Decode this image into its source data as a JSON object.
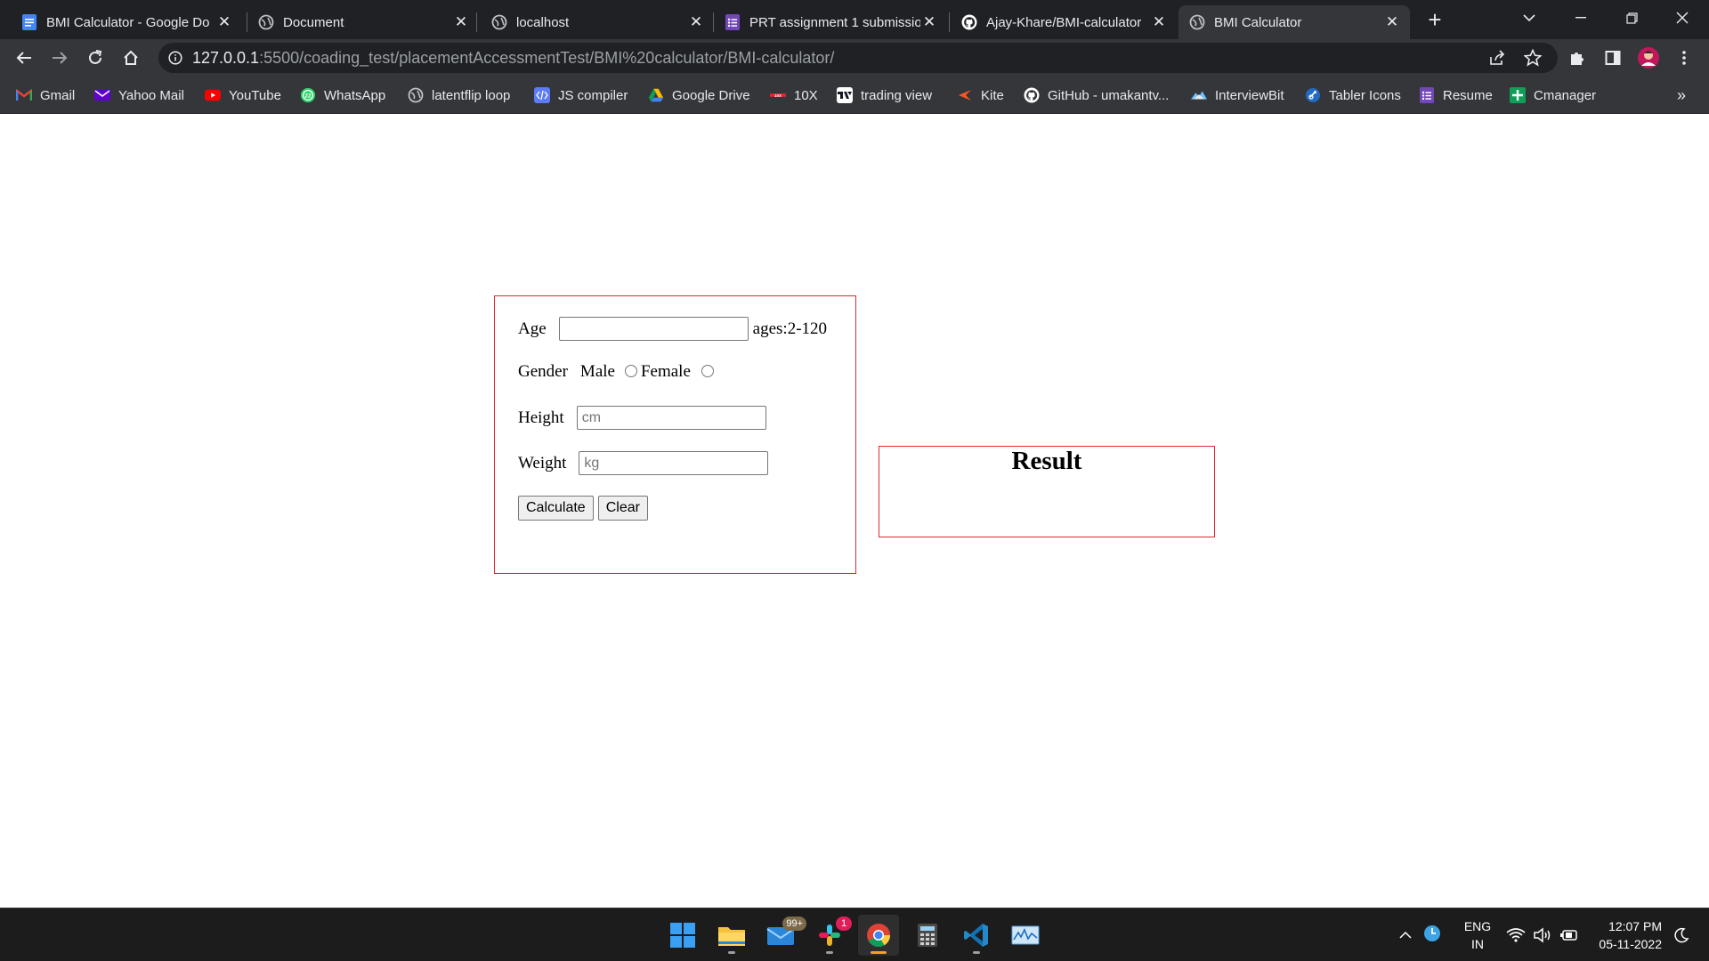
{
  "browser": {
    "tabs": [
      {
        "title": "BMI Calculator - Google Do",
        "icon": "google-docs-icon",
        "color": "#4285f4",
        "active": false
      },
      {
        "title": "Document",
        "icon": "globe-icon",
        "active": false
      },
      {
        "title": "localhost",
        "icon": "globe-icon",
        "active": false
      },
      {
        "title": "PRT assignment 1 submissio",
        "icon": "google-forms-icon",
        "color": "#673ab7",
        "active": false
      },
      {
        "title": "Ajay-Khare/BMI-calculator",
        "icon": "github-icon",
        "active": false
      },
      {
        "title": "BMI Calculator",
        "icon": "globe-icon",
        "active": true
      }
    ],
    "address": {
      "host": "127.0.0.1",
      "path": ":5500/coading_test/placementAccessmentTest/BMI%20calculator/BMI-calculator/"
    },
    "bookmarks": [
      {
        "label": "Gmail",
        "icon": "gmail-icon",
        "color": "#ea4335"
      },
      {
        "label": "Yahoo Mail",
        "icon": "yahoo-mail-icon",
        "color": "#6001d2"
      },
      {
        "label": "YouTube",
        "icon": "youtube-icon",
        "color": "#ff0000"
      },
      {
        "label": "WhatsApp",
        "icon": "whatsapp-icon",
        "color": "#25d366"
      },
      {
        "label": "latentflip loop",
        "icon": "globe-icon",
        "color": "#9aa0a6"
      },
      {
        "label": "JS compiler",
        "icon": "code-icon",
        "color": "#5b7cf6"
      },
      {
        "label": "Google Drive",
        "icon": "google-drive-icon",
        "color": "#fbbc04"
      },
      {
        "label": "10X",
        "icon": "10x-icon",
        "color": "#e0282e"
      },
      {
        "label": "trading view",
        "icon": "tradingview-icon",
        "color": "#131722"
      },
      {
        "label": "Kite",
        "icon": "kite-icon",
        "color": "#ff5722"
      },
      {
        "label": "GitHub - umakantv...",
        "icon": "github-icon",
        "color": "#ffffff"
      },
      {
        "label": "InterviewBit",
        "icon": "interviewbit-icon",
        "color": "#69c5ff"
      },
      {
        "label": "Tabler Icons",
        "icon": "tabler-icon",
        "color": "#206bc4"
      },
      {
        "label": "Resume",
        "icon": "google-forms-icon",
        "color": "#673ab7"
      },
      {
        "label": "Cmanager",
        "icon": "google-sheets-icon",
        "color": "#0f9d58"
      }
    ],
    "bookmarks_more": "»"
  },
  "page": {
    "form": {
      "age_label": "Age",
      "age_hint": "ages:2-120",
      "gender_label": "Gender",
      "male_label": "Male",
      "female_label": "Female",
      "height_label": "Height",
      "height_placeholder": "cm",
      "weight_label": "Weight",
      "weight_placeholder": "kg",
      "calculate_label": "Calculate",
      "clear_label": "Clear"
    },
    "result": {
      "heading": "Result"
    },
    "accent_color": "#e0282e"
  },
  "taskbar": {
    "mail_badge": "99+",
    "slack_badge": "1",
    "language_top": "ENG",
    "language_bottom": "IN",
    "time": "12:07 PM",
    "date": "05-11-2022"
  }
}
